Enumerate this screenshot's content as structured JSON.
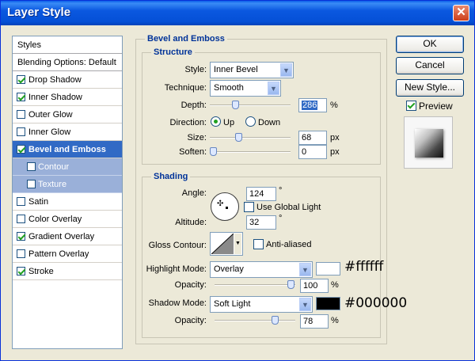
{
  "window": {
    "title": "Layer Style",
    "close_label": "✕"
  },
  "styles_list": {
    "header": "Styles",
    "blending": "Blending Options: Default",
    "items": [
      {
        "label": "Drop Shadow",
        "checked": true
      },
      {
        "label": "Inner Shadow",
        "checked": true
      },
      {
        "label": "Outer Glow",
        "checked": false
      },
      {
        "label": "Inner Glow",
        "checked": false
      },
      {
        "label": "Bevel and Emboss",
        "checked": true,
        "selected": true
      },
      {
        "label": "Contour",
        "checked": false,
        "sub": true
      },
      {
        "label": "Texture",
        "checked": false,
        "sub": true
      },
      {
        "label": "Satin",
        "checked": false
      },
      {
        "label": "Color Overlay",
        "checked": false
      },
      {
        "label": "Gradient Overlay",
        "checked": true
      },
      {
        "label": "Pattern Overlay",
        "checked": false
      },
      {
        "label": "Stroke",
        "checked": true
      }
    ]
  },
  "bevel": {
    "group_title": "Bevel and Emboss",
    "structure": {
      "title": "Structure",
      "style_label": "Style:",
      "style_value": "Inner Bevel",
      "technique_label": "Technique:",
      "technique_value": "Smooth",
      "depth_label": "Depth:",
      "depth_value": "286",
      "depth_unit": "%",
      "direction_label": "Direction:",
      "up_label": "Up",
      "down_label": "Down",
      "direction": "Up",
      "size_label": "Size:",
      "size_value": "68",
      "size_unit": "px",
      "soften_label": "Soften:",
      "soften_value": "0",
      "soften_unit": "px"
    },
    "shading": {
      "title": "Shading",
      "angle_label": "Angle:",
      "angle_value": "124",
      "angle_unit": "°",
      "global_light_label": "Use Global Light",
      "global_light": false,
      "altitude_label": "Altitude:",
      "altitude_value": "32",
      "altitude_unit": "°",
      "gloss_label": "Gloss Contour:",
      "antialiased_label": "Anti-aliased",
      "antialiased": false,
      "highlight_mode_label": "Highlight Mode:",
      "highlight_mode_value": "Overlay",
      "highlight_color": "#ffffff",
      "highlight_opacity_label": "Opacity:",
      "highlight_opacity": "100",
      "highlight_opacity_unit": "%",
      "shadow_mode_label": "Shadow Mode:",
      "shadow_mode_value": "Soft Light",
      "shadow_color": "#000000",
      "shadow_opacity_label": "Opacity:",
      "shadow_opacity": "78",
      "shadow_opacity_unit": "%"
    }
  },
  "annotations": {
    "highlight_hex": "#ffffff",
    "shadow_hex": "#000000"
  },
  "buttons": {
    "ok": "OK",
    "cancel": "Cancel",
    "new_style": "New Style...",
    "preview_label": "Preview",
    "preview_checked": true
  }
}
